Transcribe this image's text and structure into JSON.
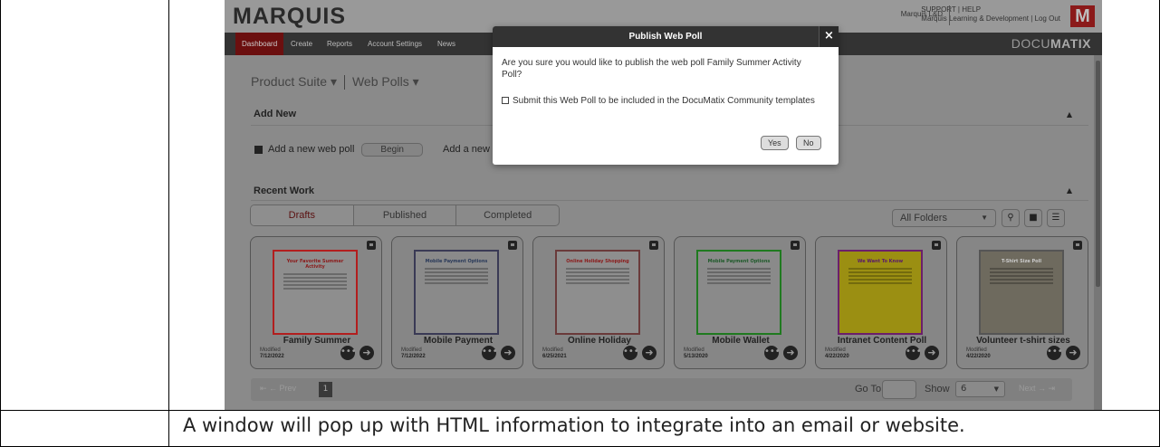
{
  "caption": "A window will pop up with HTML information to integrate into an email or website.",
  "app": {
    "logo": "MARQUIS",
    "user": "Marquis L&D",
    "support": "SUPPORT | HELP",
    "account": "Marquis Learning & Development | Log Out",
    "logo_mark": "M",
    "brand_prefix": "DOCU",
    "brand_suffix": "MATIX"
  },
  "nav": [
    "Dashboard",
    "Create",
    "Reports",
    "Account Settings",
    "News"
  ],
  "breadcrumb": {
    "suite": "Product Suite ▾",
    "section": "Web Polls ▾"
  },
  "add_new": {
    "title": "Add New",
    "item1": "Add a new web poll",
    "begin": "Begin",
    "item2": "Add a new"
  },
  "recent": {
    "title": "Recent Work",
    "tabs": [
      "Drafts",
      "Published",
      "Completed"
    ],
    "folder_select": "All Folders"
  },
  "cards": [
    {
      "title": "Family Summer",
      "modified_label": "Modified",
      "date": "7/12/2022",
      "thumb_title": "Your Favorite Summer Activity",
      "thumb_bg": "#8e8e8e",
      "border": "#b21e1e",
      "title_color": "#8b1a1a"
    },
    {
      "title": "Mobile Payment",
      "modified_label": "Modified",
      "date": "7/12/2022",
      "thumb_title": "Mobile Payment Options",
      "thumb_bg": "#8a8a8a",
      "border": "#3a3a55",
      "title_color": "#2a3a5a"
    },
    {
      "title": "Online Holiday",
      "modified_label": "Modified",
      "date": "6/25/2021",
      "thumb_title": "Online Holiday Shopping",
      "thumb_bg": "#8e8e8e",
      "border": "#6a3a3a",
      "title_color": "#8b1a1a"
    },
    {
      "title": "Mobile Wallet",
      "modified_label": "Modified",
      "date": "5/13/2020",
      "thumb_title": "Mobile Payment Options",
      "thumb_bg": "#8a8a8a",
      "border": "#1f7a1f",
      "title_color": "#1f5a2a"
    },
    {
      "title": "Intranet Content Poll",
      "modified_label": "Modified",
      "date": "4/22/2020",
      "thumb_title": "We Want To Know",
      "thumb_bg": "#9b8f12",
      "border": "#6b1f6b",
      "title_color": "#5a1a6a"
    },
    {
      "title": "Volunteer t-shirt sizes",
      "modified_label": "Modified",
      "date": "4/22/2020",
      "thumb_title": "T-Shirt Size Poll",
      "thumb_bg": "#6e6a5e",
      "border": "#555555",
      "title_color": "#cccccc"
    }
  ],
  "pager": {
    "prev": "⇤  ← Prev",
    "page": "1",
    "goto": "Go To",
    "show": "Show",
    "show_value": "6",
    "next": "Next →  ⇥"
  },
  "modal": {
    "title": "Publish Web Poll",
    "close": "×",
    "question": "Are you sure you would like to publish the web poll Family Summer Activity Poll?",
    "checkbox_label": "Submit this Web Poll to be included in the DocuMatix Community templates",
    "yes": "Yes",
    "no": "No"
  }
}
